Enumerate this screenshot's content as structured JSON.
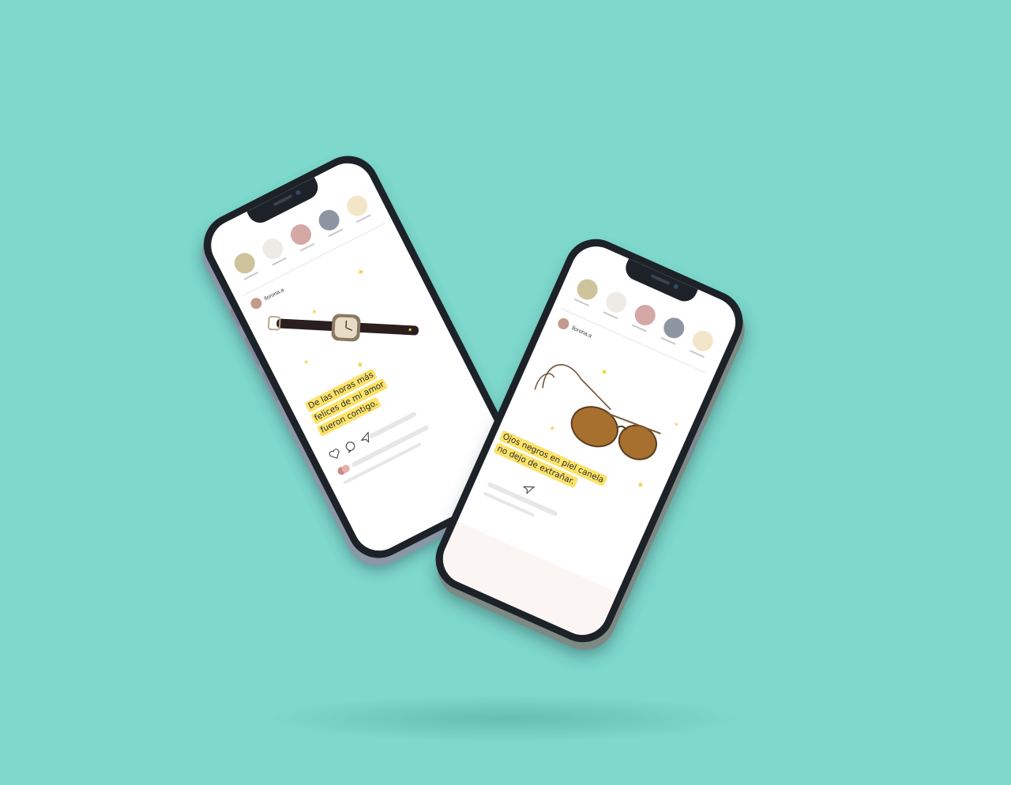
{
  "colors": {
    "background": "#7ed8cc",
    "highlight": "#fbe26a",
    "sparkle": "#f2d34a"
  },
  "phones": [
    {
      "username": "llorona.a",
      "palette": [
        "#cfc39c",
        "#ecebe5",
        "#d4a8a4",
        "#8e95a2",
        "#f3e6c8"
      ],
      "caption_lines": [
        "De las horas más",
        "felices de mi amor",
        "fueron contigo."
      ],
      "illustration": "wristwatch-illustration",
      "icons": [
        "heart-icon",
        "comment-icon",
        "send-icon"
      ]
    },
    {
      "username": "llorona.a",
      "palette": [
        "#cfc39c",
        "#ecebe5",
        "#d4a8a4",
        "#8e95a2",
        "#f3e6c8"
      ],
      "caption_lines": [
        "Ojos negros en piel canela",
        "no dejo de extrañar."
      ],
      "illustration": "sunglasses-illustration",
      "icons": [
        "send-icon"
      ]
    }
  ]
}
